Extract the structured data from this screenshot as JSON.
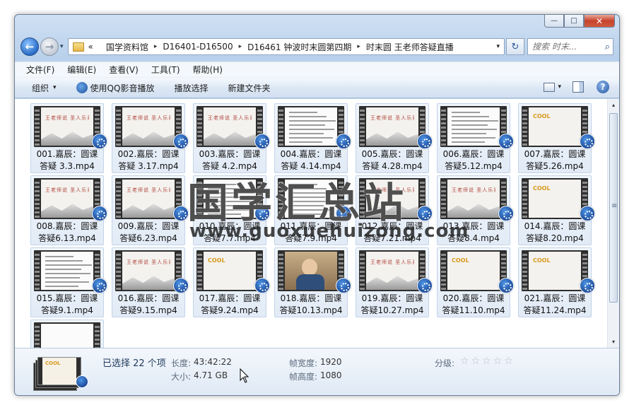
{
  "window": {
    "minimize_glyph": "—",
    "maximize_glyph": "□",
    "close_glyph": "✕"
  },
  "nav": {
    "back_glyph": "←",
    "forward_glyph": "→",
    "history_glyph": "▾",
    "breadcrumb_prefix": "«",
    "breadcrumbs": [
      "国学资料馆",
      "D16401-D16500",
      "D16461 钟波时末圆第四期",
      "时末圆 王老师答疑直播"
    ],
    "separator_glyph": "▸",
    "dropdown_glyph": "▾",
    "refresh_glyph": "↻",
    "search_placeholder": "搜索 时末...",
    "search_icon_glyph": "⌕"
  },
  "menu": [
    "文件(F)",
    "编辑(E)",
    "查看(V)",
    "工具(T)",
    "帮助(H)"
  ],
  "toolbar": {
    "organize": "组织",
    "organize_arrow": "▾",
    "play_qq": "使用QQ影音播放",
    "play_selection": "播放选择",
    "new_folder": "新建文件夹",
    "view_arrow": "▾",
    "help_glyph": "?"
  },
  "files": [
    {
      "line1": "001.嘉辰：圆课",
      "line2": "答疑 3.3.mp4",
      "thumb": "slide",
      "caption": "王老师说 圣人乐易"
    },
    {
      "line1": "002.嘉辰：圆课",
      "line2": "答疑 3.17.mp4",
      "thumb": "slide",
      "caption": "王老师说 圣人乐易"
    },
    {
      "line1": "003.嘉辰：圆课",
      "line2": "答疑 4.2.mp4",
      "thumb": "slide",
      "caption": "王老师说 圣人乐易"
    },
    {
      "line1": "004.嘉辰：圆课",
      "line2": "答疑 4.14.mp4",
      "thumb": "doc",
      "caption": ""
    },
    {
      "line1": "005.嘉辰：圆课",
      "line2": "答疑 4.28.mp4",
      "thumb": "slide",
      "caption": "王老师说 圣人乐易"
    },
    {
      "line1": "006.嘉辰：圆课",
      "line2": "答疑5.12.mp4",
      "thumb": "doc",
      "caption": ""
    },
    {
      "line1": "007.嘉辰：圆课",
      "line2": "答疑5.26.mp4",
      "thumb": "accent",
      "caption": "COOL"
    },
    {
      "line1": "008.嘉辰：圆课",
      "line2": "答疑6.13.mp4",
      "thumb": "slide",
      "caption": "王老师说 圣人乐易"
    },
    {
      "line1": "009.嘉辰：圆课",
      "line2": "答疑6.23.mp4",
      "thumb": "slide",
      "caption": "王老师说 圣人乐易"
    },
    {
      "line1": "010.嘉辰：圆课",
      "line2": "答疑7.7.mp4",
      "thumb": "doc",
      "caption": ""
    },
    {
      "line1": "011.嘉辰：圆课",
      "line2": "答疑7.9.mp4",
      "thumb": "doc",
      "caption": ""
    },
    {
      "line1": "012.嘉辰：圆课",
      "line2": "答疑7.21.mp4",
      "thumb": "slide",
      "caption": "王老师说 圣人乐易"
    },
    {
      "line1": "013.嘉辰：圆课",
      "line2": "答疑8.4.mp4",
      "thumb": "slide",
      "caption": "王老师说 圣人乐易"
    },
    {
      "line1": "014.嘉辰：圆课",
      "line2": "答疑8.20.mp4",
      "thumb": "accent",
      "caption": "COOL"
    },
    {
      "line1": "015.嘉辰：圆课",
      "line2": "答疑9.1.mp4",
      "thumb": "doc",
      "caption": ""
    },
    {
      "line1": "016.嘉辰：圆课",
      "line2": "答疑9.15.mp4",
      "thumb": "slide",
      "caption": "王老师说 圣人乐易"
    },
    {
      "line1": "017.嘉辰：圆课",
      "line2": "答疑9.24.mp4",
      "thumb": "accent",
      "caption": "COOL"
    },
    {
      "line1": "018.嘉辰：圆课",
      "line2": "答疑10.13.mp4",
      "thumb": "person",
      "caption": ""
    },
    {
      "line1": "019.嘉辰：圆课",
      "line2": "答疑10.27.mp4",
      "thumb": "slide",
      "caption": "王老师说 圣人乐易"
    },
    {
      "line1": "020.嘉辰：圆课",
      "line2": "答疑11.10.mp4",
      "thumb": "accent",
      "caption": "COOL"
    },
    {
      "line1": "021.嘉辰：圆课",
      "line2": "答疑11.24.mp4",
      "thumb": "accent",
      "caption": "COOL"
    },
    {
      "line1": "",
      "line2": "",
      "thumb": "partial",
      "caption": ""
    }
  ],
  "scroll": {
    "up_glyph": "▴",
    "down_glyph": "▾"
  },
  "watermark": {
    "title": "国学汇总站",
    "url": "www.guoxuehuizong.com"
  },
  "details": {
    "selected": "已选择 22 个项",
    "length_label": "长度:",
    "length_value": "43:42:22",
    "size_label": "大小:",
    "size_value": "4.71 GB",
    "width_label": "帧宽度:",
    "width_value": "1920",
    "height_label": "帧高度:",
    "height_value": "1080",
    "rating_label": "分级:",
    "rating_stars": 0,
    "star_glyph": "☆"
  },
  "colors": {
    "window_frame": "#b9d1ec",
    "accent_blue": "#1c4b9a",
    "close_red": "#c7432b"
  }
}
